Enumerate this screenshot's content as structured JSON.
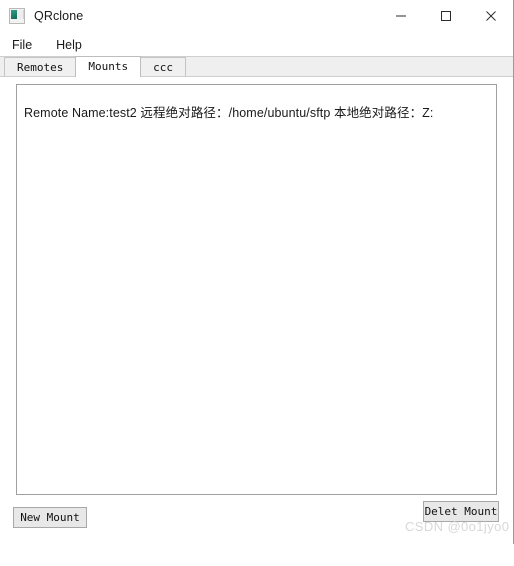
{
  "window": {
    "title": "QRclone",
    "icon_name": "app-icon",
    "controls": [
      {
        "name": "minimize",
        "glyph": "minimize-icon"
      },
      {
        "name": "maximize",
        "glyph": "maximize-icon"
      },
      {
        "name": "close",
        "glyph": "close-icon"
      }
    ]
  },
  "menu": {
    "items": [
      {
        "label": "File"
      },
      {
        "label": "Help"
      }
    ]
  },
  "tabs": [
    {
      "label": "Remotes",
      "active": false
    },
    {
      "label": "Mounts",
      "active": true
    },
    {
      "label": "ccc",
      "active": false
    }
  ],
  "mounts_panel": {
    "rows": [
      {
        "text": "Remote Name:test2    远程绝对路径：/home/ubuntu/sftp 本地绝对路径：Z:"
      }
    ]
  },
  "buttons": {
    "new_mount_label": "New Mount",
    "delete_mount_label": "Delet Mount"
  },
  "watermark": {
    "text": "CSDN @0o1jyo0"
  },
  "colors": {
    "tab_strip_bg": "#efefef",
    "panel_border": "#a0a0a0",
    "button_bg": "#e8e8e8",
    "icon_teal": "#1d7f6c",
    "watermark": "#d8d8d8"
  }
}
